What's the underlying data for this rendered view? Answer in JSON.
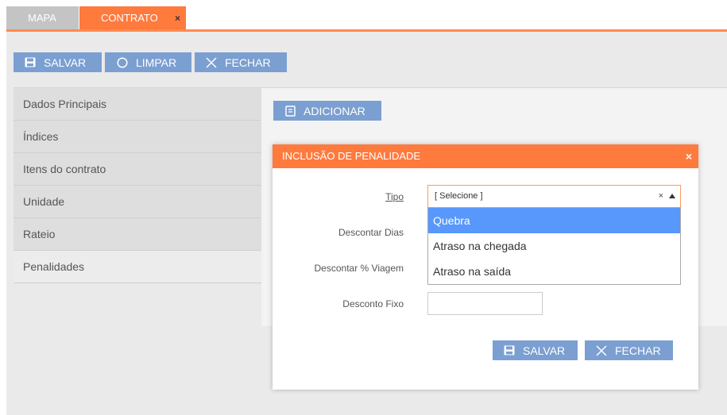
{
  "tabs": [
    {
      "label": "MAPA"
    },
    {
      "label": "CONTRATO",
      "close": "×"
    }
  ],
  "toolbar": {
    "save_label": "SALVAR",
    "clear_label": "LIMPAR",
    "close_label": "FECHAR"
  },
  "sidebar": {
    "items": [
      {
        "label": "Dados Principais"
      },
      {
        "label": "Índices"
      },
      {
        "label": "Itens do contrato"
      },
      {
        "label": "Unidade"
      },
      {
        "label": "Rateio"
      },
      {
        "label": "Penalidades",
        "active": true
      }
    ]
  },
  "content": {
    "add_label": "ADICIONAR"
  },
  "modal": {
    "title": "INCLUSÃO DE PENALIDADE",
    "close": "×",
    "fields": {
      "tipo_label": "Tipo",
      "descontar_dias_label": "Descontar Dias",
      "descontar_viagem_label": "Descontar % Viagem",
      "desconto_fixo_label": "Desconto Fixo"
    },
    "select": {
      "value": "[ Selecione ]",
      "clear": "×",
      "options": [
        "Quebra",
        "Atraso na chegada",
        "Atraso na saída"
      ],
      "highlighted": "Quebra"
    },
    "save_label": "SALVAR",
    "close_label": "FECHAR"
  },
  "colors": {
    "accent_orange": "#ff7a3d",
    "button_blue": "#7b9fd1",
    "highlight_blue": "#5897fb",
    "tab_inactive": "#c4c4c4"
  },
  "icons": {
    "save": "save-icon",
    "clear": "circle-icon",
    "close": "x-icon",
    "add": "document-icon"
  }
}
